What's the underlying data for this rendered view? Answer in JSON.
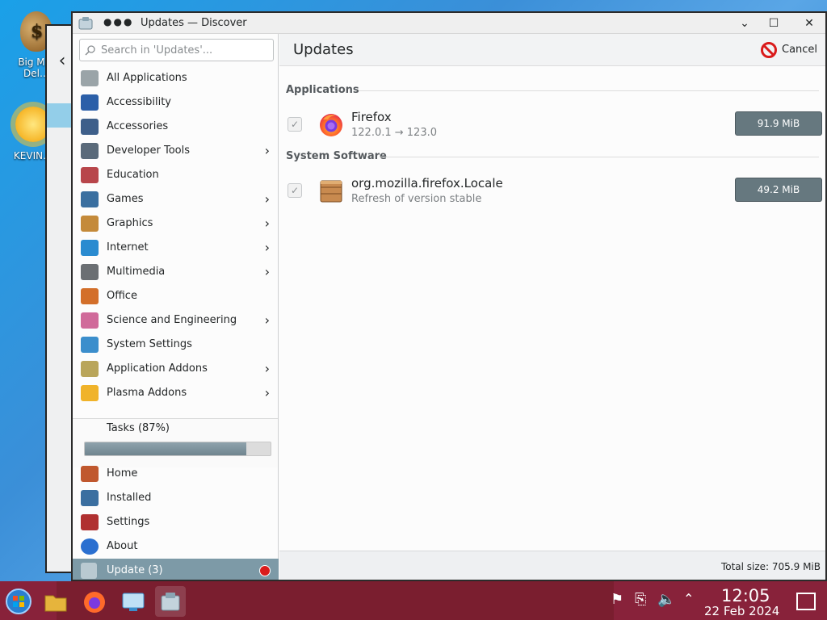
{
  "desktop": {
    "icons": [
      {
        "label": "Big M… Del…"
      },
      {
        "label": "KEVIN…"
      }
    ]
  },
  "window": {
    "title": "Updates — Discover",
    "controls": {
      "minimize": "⌄",
      "maximize": "☐",
      "close": "✕"
    }
  },
  "sidebar": {
    "search_placeholder": "Search in 'Updates'...",
    "categories": [
      {
        "label": "All Applications",
        "icon": "all-apps-icon",
        "color": "#9aa4a8",
        "has_children": false
      },
      {
        "label": "Accessibility",
        "icon": "accessibility-icon",
        "color": "#2b5fa8",
        "has_children": false
      },
      {
        "label": "Accessories",
        "icon": "accessories-icon",
        "color": "#3e5f8a",
        "has_children": false
      },
      {
        "label": "Developer Tools",
        "icon": "developer-tools-icon",
        "color": "#5a6a7a",
        "has_children": true
      },
      {
        "label": "Education",
        "icon": "education-icon",
        "color": "#b8464b",
        "has_children": false
      },
      {
        "label": "Games",
        "icon": "games-icon",
        "color": "#3a6fa0",
        "has_children": true
      },
      {
        "label": "Graphics",
        "icon": "graphics-icon",
        "color": "#c48a3a",
        "has_children": true
      },
      {
        "label": "Internet",
        "icon": "internet-icon",
        "color": "#2a8bd0",
        "has_children": true
      },
      {
        "label": "Multimedia",
        "icon": "multimedia-icon",
        "color": "#6b6f73",
        "has_children": true
      },
      {
        "label": "Office",
        "icon": "office-icon",
        "color": "#d36f2a",
        "has_children": false
      },
      {
        "label": "Science and Engineering",
        "icon": "science-icon",
        "color": "#d06a9a",
        "has_children": true
      },
      {
        "label": "System Settings",
        "icon": "system-settings-icon",
        "color": "#3b8ecc",
        "has_children": false
      },
      {
        "label": "Application Addons",
        "icon": "app-addons-icon",
        "color": "#b9a55a",
        "has_children": true
      },
      {
        "label": "Plasma Addons",
        "icon": "plasma-addons-icon",
        "color": "#f0b32a",
        "has_children": true
      }
    ],
    "tasks_label": "Tasks (87%)",
    "tasks_progress": 0.87,
    "bottom": [
      {
        "label": "Home",
        "icon": "home-icon",
        "color": "#c0582e"
      },
      {
        "label": "Installed",
        "icon": "installed-icon",
        "color": "#3b6fa0"
      },
      {
        "label": "Settings",
        "icon": "settings-icon",
        "color": "#b03030"
      },
      {
        "label": "About",
        "icon": "about-icon",
        "color": "#2a6fd0"
      }
    ],
    "update": {
      "label": "Update (3)",
      "icon": "update-icon"
    }
  },
  "main": {
    "title": "Updates",
    "cancel_label": "Cancel",
    "sections": [
      {
        "header": "Applications",
        "items": [
          {
            "name": "Firefox",
            "subtitle": "122.0.1 → 123.0",
            "size": "91.9 MiB",
            "icon": "firefox-icon",
            "checked": true
          }
        ]
      },
      {
        "header": "System Software",
        "items": [
          {
            "name": "org.mozilla.firefox.Locale",
            "subtitle": "Refresh of version stable",
            "size": "49.2 MiB",
            "icon": "package-icon",
            "checked": true
          }
        ]
      }
    ],
    "total_size": "Total size: 705.9 MiB"
  },
  "taskbar": {
    "clock_time": "12:05",
    "clock_date": "22 Feb 2024"
  }
}
